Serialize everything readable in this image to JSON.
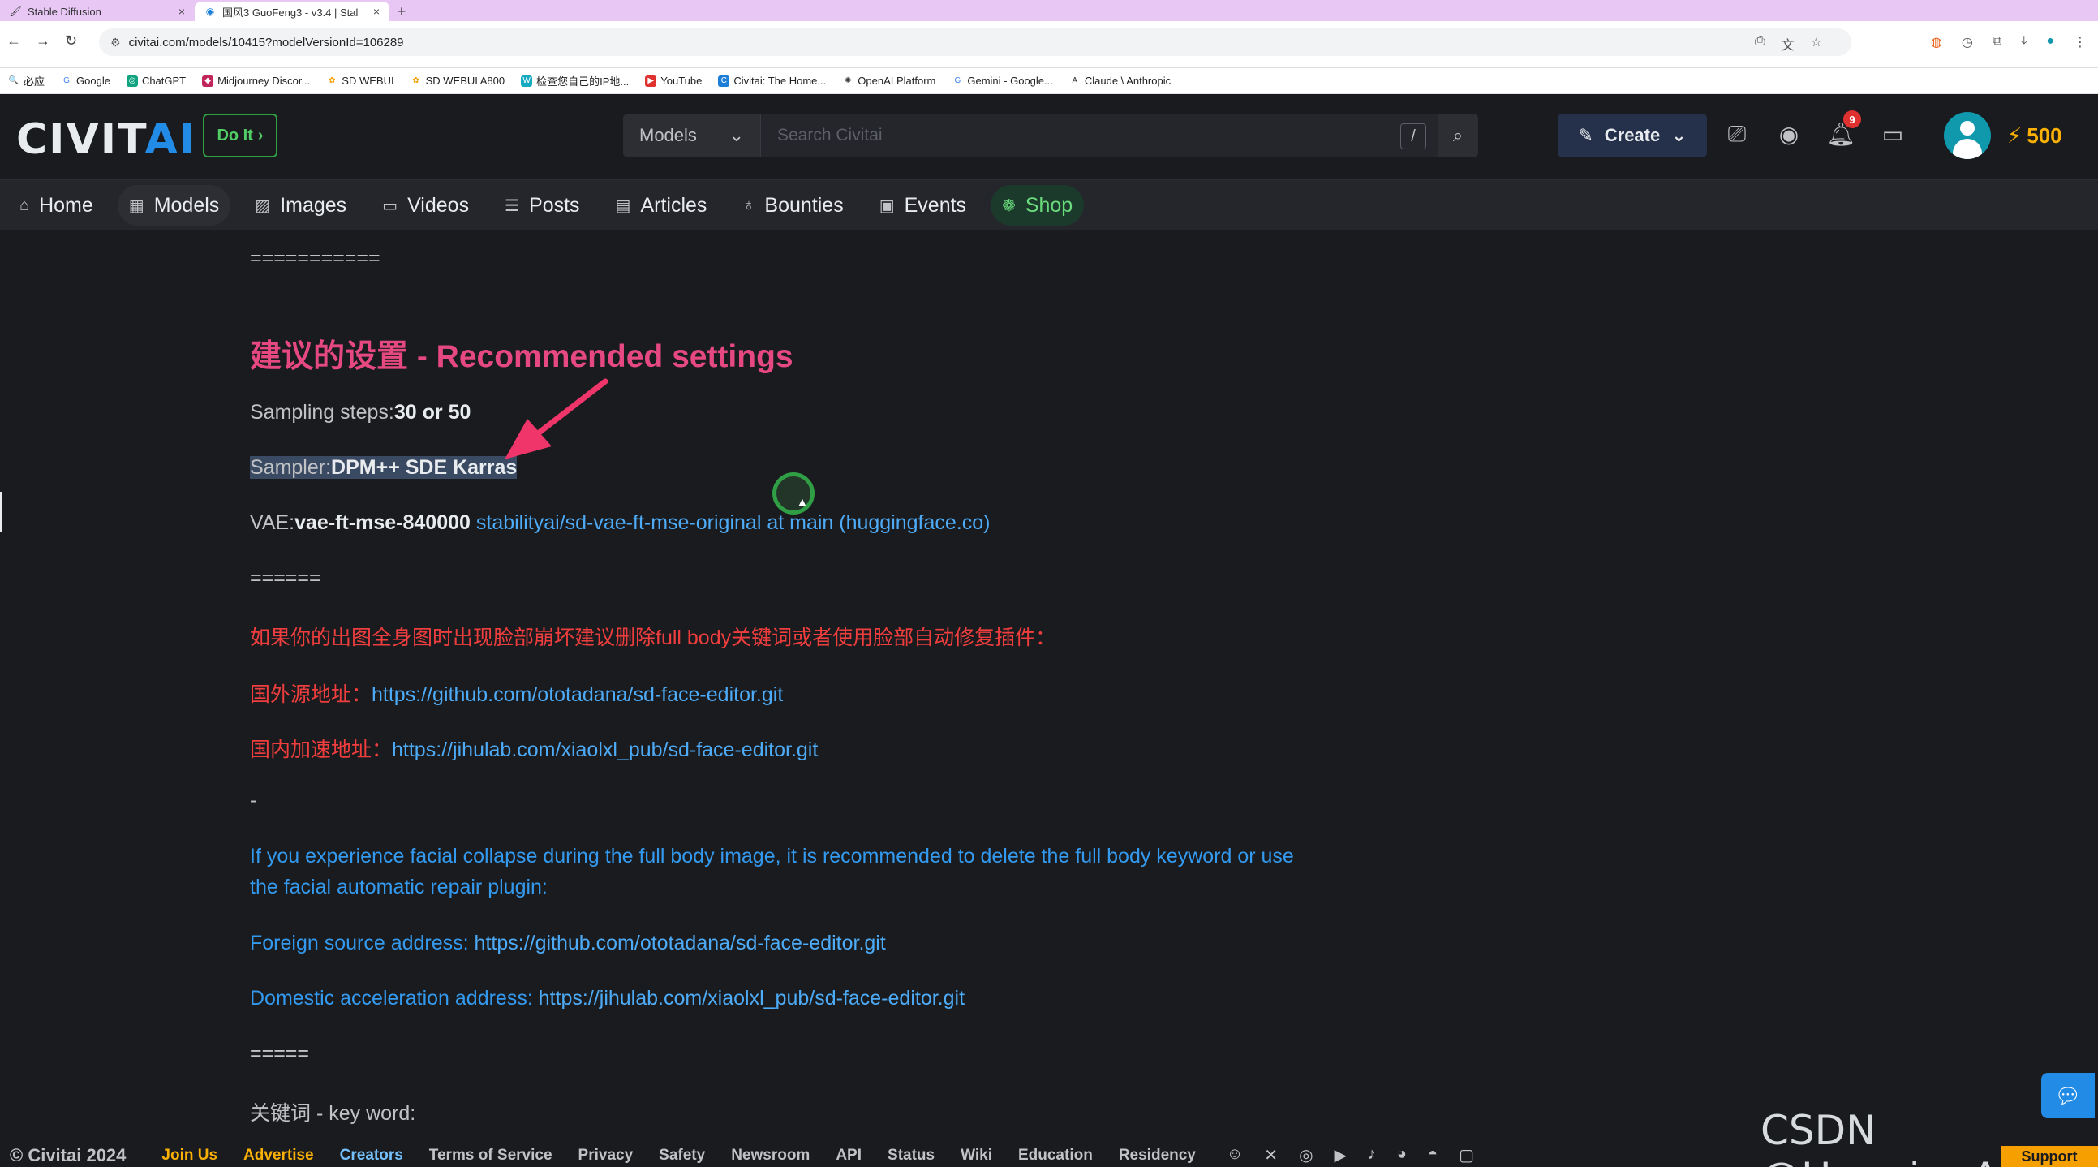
{
  "browser": {
    "tabs": [
      {
        "label": "Stable Diffusion",
        "active": false
      },
      {
        "label": "国风3 GuoFeng3 - v3.4 | Stal",
        "active": true
      }
    ],
    "url": "civitai.com/models/10415?modelVersionId=106289",
    "bookmarks": [
      "必应",
      "Google",
      "ChatGPT",
      "Midjourney Discor...",
      "SD WEBUI",
      "SD WEBUI A800",
      "检查您自己的IP地...",
      "YouTube",
      "Civitai: The Home...",
      "OpenAI Platform",
      "Gemini - Google...",
      "Claude \\ Anthropic"
    ]
  },
  "header": {
    "logo_main": "CIVIT",
    "logo_ai": "AI",
    "doit_label": "Do It",
    "search_category": "Models",
    "search_placeholder": "Search Civitai",
    "search_shortcut": "/",
    "create_label": "Create",
    "notification_count": "9",
    "buzz_amount": "500"
  },
  "nav": {
    "home": "Home",
    "models": "Models",
    "images": "Images",
    "videos": "Videos",
    "posts": "Posts",
    "articles": "Articles",
    "bounties": "Bounties",
    "events": "Events",
    "shop": "Shop"
  },
  "content": {
    "sep1": "===========",
    "heading": "建议的设置 - Recommended settings",
    "steps_label": "Sampling steps:",
    "steps_value": "30 or 50",
    "sampler_label": "Sampler:",
    "sampler_value": "DPM++ SDE Karras",
    "vae_label": "VAE:",
    "vae_value": "vae-ft-mse-840000",
    "vae_link": "stabilityai/sd-vae-ft-mse-original at main (huggingface.co)",
    "sep2": "======",
    "cn_tip": "如果你的出图全身图时出现脸部崩坏建议删除full body关键词或者使用脸部自动修复插件：",
    "cn_foreign_label": "国外源地址：",
    "cn_foreign_link": "https://github.com/ototadana/sd-face-editor.git",
    "cn_domestic_label": "国内加速地址：",
    "cn_domestic_link": "https://jihulab.com/xiaolxl_pub/sd-face-editor.git",
    "dash": "-",
    "en_tip": "If you experience facial collapse during the full body image, it is recommended to delete the full body keyword or use the facial automatic repair plugin:",
    "en_foreign_label": "Foreign source address:",
    "en_foreign_link": "https://github.com/ototadana/sd-face-editor.git",
    "en_domestic_label": "Domestic acceleration address:",
    "en_domestic_link": "https://jihulab.com/xiaolxl_pub/sd-face-editor.git",
    "sep3": "=====",
    "keyword_label": "关键词 - key word:"
  },
  "footer": {
    "copyright": "© Civitai 2024",
    "links": [
      "Join Us",
      "Advertise",
      "Creators",
      "Terms of Service",
      "Privacy",
      "Safety",
      "Newsroom",
      "API",
      "Status",
      "Wiki",
      "Education",
      "Residency"
    ],
    "support": "Support"
  },
  "watermark": "CSDN @HuggingAI",
  "colors": {
    "accent": "#228be6",
    "heading_pink": "#e64980",
    "warning_red": "#f03e3e",
    "link_blue": "#4dabf7",
    "annotation_arrow": "#f0356b"
  }
}
